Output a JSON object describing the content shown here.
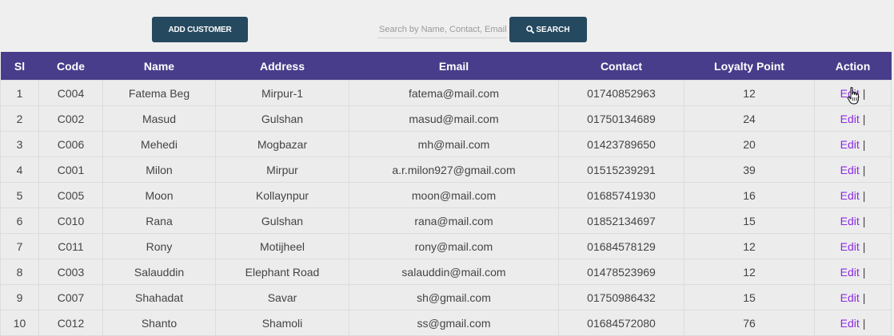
{
  "toolbar": {
    "add_label": "ADD CUSTOMER",
    "search_placeholder": "Search by Name, Contact, Email",
    "search_value": "",
    "search_label": "SEARCH"
  },
  "table": {
    "headers": [
      "Sl",
      "Code",
      "Name",
      "Address",
      "Email",
      "Contact",
      "Loyalty Point",
      "Action"
    ],
    "edit_label": "Edit",
    "separator": "|",
    "rows": [
      {
        "sl": "1",
        "code": "C004",
        "name": "Fatema Beg",
        "address": "Mirpur-1",
        "email": "fatema@mail.com",
        "contact": "01740852963",
        "points": "12"
      },
      {
        "sl": "2",
        "code": "C002",
        "name": "Masud",
        "address": "Gulshan",
        "email": "masud@mail.com",
        "contact": "01750134689",
        "points": "24"
      },
      {
        "sl": "3",
        "code": "C006",
        "name": "Mehedi",
        "address": "Mogbazar",
        "email": "mh@mail.com",
        "contact": "01423789650",
        "points": "20"
      },
      {
        "sl": "4",
        "code": "C001",
        "name": "Milon",
        "address": "Mirpur",
        "email": "a.r.milon927@gmail.com",
        "contact": "01515239291",
        "points": "39"
      },
      {
        "sl": "5",
        "code": "C005",
        "name": "Moon",
        "address": "Kollaynpur",
        "email": "moon@mail.com",
        "contact": "01685741930",
        "points": "16"
      },
      {
        "sl": "6",
        "code": "C010",
        "name": "Rana",
        "address": "Gulshan",
        "email": "rana@mail.com",
        "contact": "01852134697",
        "points": "15"
      },
      {
        "sl": "7",
        "code": "C011",
        "name": "Rony",
        "address": "Motijheel",
        "email": "rony@mail.com",
        "contact": "01684578129",
        "points": "12"
      },
      {
        "sl": "8",
        "code": "C003",
        "name": "Salauddin",
        "address": "Elephant Road",
        "email": "salauddin@mail.com",
        "contact": "01478523969",
        "points": "12"
      },
      {
        "sl": "9",
        "code": "C007",
        "name": "Shahadat",
        "address": "Savar",
        "email": "sh@gmail.com",
        "contact": "01750986432",
        "points": "15"
      },
      {
        "sl": "10",
        "code": "C012",
        "name": "Shanto",
        "address": "Shamoli",
        "email": "ss@gmail.com",
        "contact": "01684572080",
        "points": "76"
      }
    ]
  },
  "colors": {
    "button_bg": "#25495f",
    "header_bg": "#483d8b",
    "edit_link": "#8a2be2",
    "page_bg": "#efefef"
  },
  "icons": {
    "search": "search-icon",
    "cursor": "hand-pointer-icon"
  }
}
